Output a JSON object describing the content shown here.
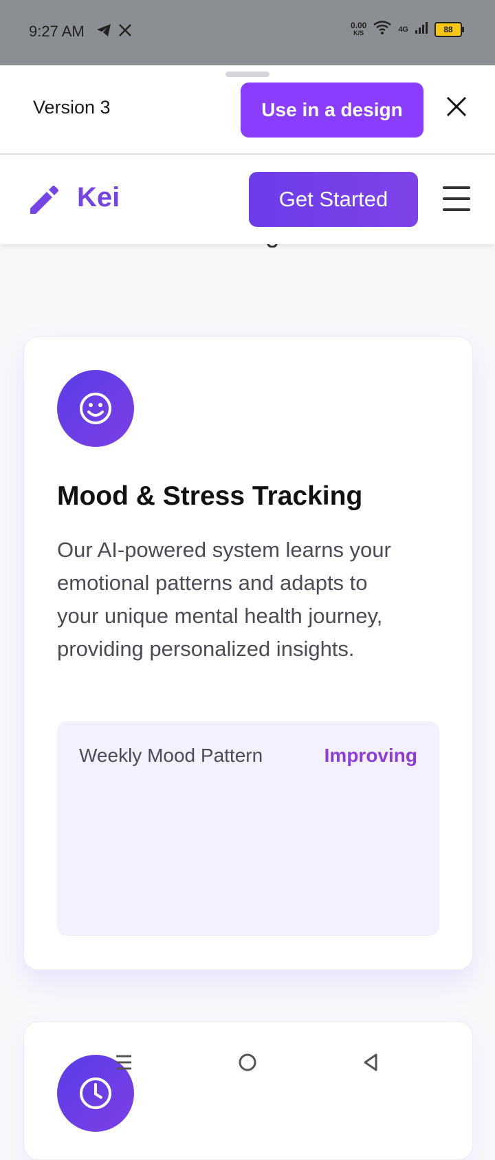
{
  "status_bar": {
    "time": "9:27 AM",
    "net_speed_value": "0.00",
    "net_speed_unit": "K/S",
    "network_type": "4G",
    "battery_level": "88"
  },
  "version_bar": {
    "version_label": "Version 3",
    "use_design_label": "Use in a design"
  },
  "app_header": {
    "logo_text": "Kei",
    "get_started_label": "Get Started"
  },
  "feature_card": {
    "title": "Mood & Stress Tracking",
    "description": "Our AI-powered system learns your emotional patterns and adapts to your unique mental health journey, providing personalized insights.",
    "panel": {
      "label": "Weekly Mood Pattern",
      "status": "Improving"
    }
  },
  "colors": {
    "accent": "#8b3dff",
    "brand": "#7544e4",
    "status_improving": "#8b3dd6",
    "panel_bg": "#f4f1fe"
  },
  "icons": {
    "feature_icon": "smile-icon",
    "feature_icon_2": "clock-icon",
    "logo_icon": "pencil-icon"
  }
}
